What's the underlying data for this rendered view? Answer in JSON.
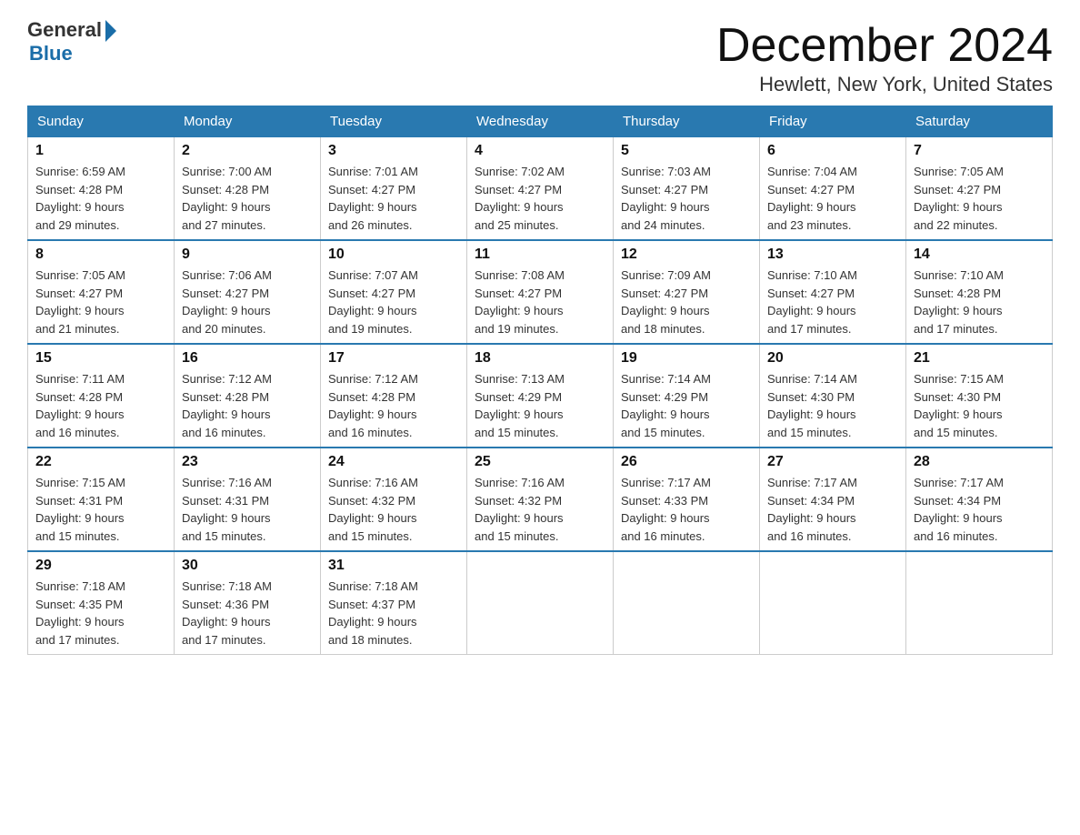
{
  "header": {
    "logo_general": "General",
    "logo_blue": "Blue",
    "month_title": "December 2024",
    "location": "Hewlett, New York, United States"
  },
  "days_of_week": [
    "Sunday",
    "Monday",
    "Tuesday",
    "Wednesday",
    "Thursday",
    "Friday",
    "Saturday"
  ],
  "weeks": [
    [
      {
        "day": "1",
        "sunrise": "6:59 AM",
        "sunset": "4:28 PM",
        "daylight": "9 hours and 29 minutes."
      },
      {
        "day": "2",
        "sunrise": "7:00 AM",
        "sunset": "4:28 PM",
        "daylight": "9 hours and 27 minutes."
      },
      {
        "day": "3",
        "sunrise": "7:01 AM",
        "sunset": "4:27 PM",
        "daylight": "9 hours and 26 minutes."
      },
      {
        "day": "4",
        "sunrise": "7:02 AM",
        "sunset": "4:27 PM",
        "daylight": "9 hours and 25 minutes."
      },
      {
        "day": "5",
        "sunrise": "7:03 AM",
        "sunset": "4:27 PM",
        "daylight": "9 hours and 24 minutes."
      },
      {
        "day": "6",
        "sunrise": "7:04 AM",
        "sunset": "4:27 PM",
        "daylight": "9 hours and 23 minutes."
      },
      {
        "day": "7",
        "sunrise": "7:05 AM",
        "sunset": "4:27 PM",
        "daylight": "9 hours and 22 minutes."
      }
    ],
    [
      {
        "day": "8",
        "sunrise": "7:05 AM",
        "sunset": "4:27 PM",
        "daylight": "9 hours and 21 minutes."
      },
      {
        "day": "9",
        "sunrise": "7:06 AM",
        "sunset": "4:27 PM",
        "daylight": "9 hours and 20 minutes."
      },
      {
        "day": "10",
        "sunrise": "7:07 AM",
        "sunset": "4:27 PM",
        "daylight": "9 hours and 19 minutes."
      },
      {
        "day": "11",
        "sunrise": "7:08 AM",
        "sunset": "4:27 PM",
        "daylight": "9 hours and 19 minutes."
      },
      {
        "day": "12",
        "sunrise": "7:09 AM",
        "sunset": "4:27 PM",
        "daylight": "9 hours and 18 minutes."
      },
      {
        "day": "13",
        "sunrise": "7:10 AM",
        "sunset": "4:27 PM",
        "daylight": "9 hours and 17 minutes."
      },
      {
        "day": "14",
        "sunrise": "7:10 AM",
        "sunset": "4:28 PM",
        "daylight": "9 hours and 17 minutes."
      }
    ],
    [
      {
        "day": "15",
        "sunrise": "7:11 AM",
        "sunset": "4:28 PM",
        "daylight": "9 hours and 16 minutes."
      },
      {
        "day": "16",
        "sunrise": "7:12 AM",
        "sunset": "4:28 PM",
        "daylight": "9 hours and 16 minutes."
      },
      {
        "day": "17",
        "sunrise": "7:12 AM",
        "sunset": "4:28 PM",
        "daylight": "9 hours and 16 minutes."
      },
      {
        "day": "18",
        "sunrise": "7:13 AM",
        "sunset": "4:29 PM",
        "daylight": "9 hours and 15 minutes."
      },
      {
        "day": "19",
        "sunrise": "7:14 AM",
        "sunset": "4:29 PM",
        "daylight": "9 hours and 15 minutes."
      },
      {
        "day": "20",
        "sunrise": "7:14 AM",
        "sunset": "4:30 PM",
        "daylight": "9 hours and 15 minutes."
      },
      {
        "day": "21",
        "sunrise": "7:15 AM",
        "sunset": "4:30 PM",
        "daylight": "9 hours and 15 minutes."
      }
    ],
    [
      {
        "day": "22",
        "sunrise": "7:15 AM",
        "sunset": "4:31 PM",
        "daylight": "9 hours and 15 minutes."
      },
      {
        "day": "23",
        "sunrise": "7:16 AM",
        "sunset": "4:31 PM",
        "daylight": "9 hours and 15 minutes."
      },
      {
        "day": "24",
        "sunrise": "7:16 AM",
        "sunset": "4:32 PM",
        "daylight": "9 hours and 15 minutes."
      },
      {
        "day": "25",
        "sunrise": "7:16 AM",
        "sunset": "4:32 PM",
        "daylight": "9 hours and 15 minutes."
      },
      {
        "day": "26",
        "sunrise": "7:17 AM",
        "sunset": "4:33 PM",
        "daylight": "9 hours and 16 minutes."
      },
      {
        "day": "27",
        "sunrise": "7:17 AM",
        "sunset": "4:34 PM",
        "daylight": "9 hours and 16 minutes."
      },
      {
        "day": "28",
        "sunrise": "7:17 AM",
        "sunset": "4:34 PM",
        "daylight": "9 hours and 16 minutes."
      }
    ],
    [
      {
        "day": "29",
        "sunrise": "7:18 AM",
        "sunset": "4:35 PM",
        "daylight": "9 hours and 17 minutes."
      },
      {
        "day": "30",
        "sunrise": "7:18 AM",
        "sunset": "4:36 PM",
        "daylight": "9 hours and 17 minutes."
      },
      {
        "day": "31",
        "sunrise": "7:18 AM",
        "sunset": "4:37 PM",
        "daylight": "9 hours and 18 minutes."
      },
      null,
      null,
      null,
      null
    ]
  ],
  "labels": {
    "sunrise": "Sunrise:",
    "sunset": "Sunset:",
    "daylight": "Daylight:"
  }
}
